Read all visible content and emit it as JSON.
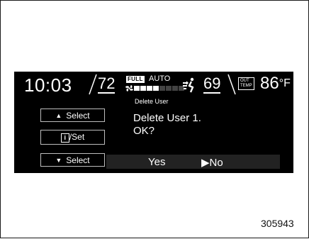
{
  "status_bar": {
    "time": "10:03",
    "driver_temp": "72",
    "climate_mode_badge": "FULL",
    "climate_mode": "AUTO",
    "fan_level": 0.5,
    "passenger_temp": "69",
    "outside_temp_label_line1": "OUT",
    "outside_temp_label_line2": "TEMP",
    "outside_temp_value": "86",
    "outside_temp_unit": "°F"
  },
  "dialog": {
    "title": "Delete User",
    "message_line1": "Delete User 1.",
    "message_line2": "OK?",
    "option_yes": "Yes",
    "option_no": "No"
  },
  "buttons": {
    "select_up_label": "Select",
    "set_label": "/Set",
    "info_glyph": "i",
    "select_down_label": "Select"
  },
  "figure_number": "305943",
  "colors": {
    "screen": "#000000",
    "text": "#ffffff",
    "button_border": "#bdbdbd"
  }
}
